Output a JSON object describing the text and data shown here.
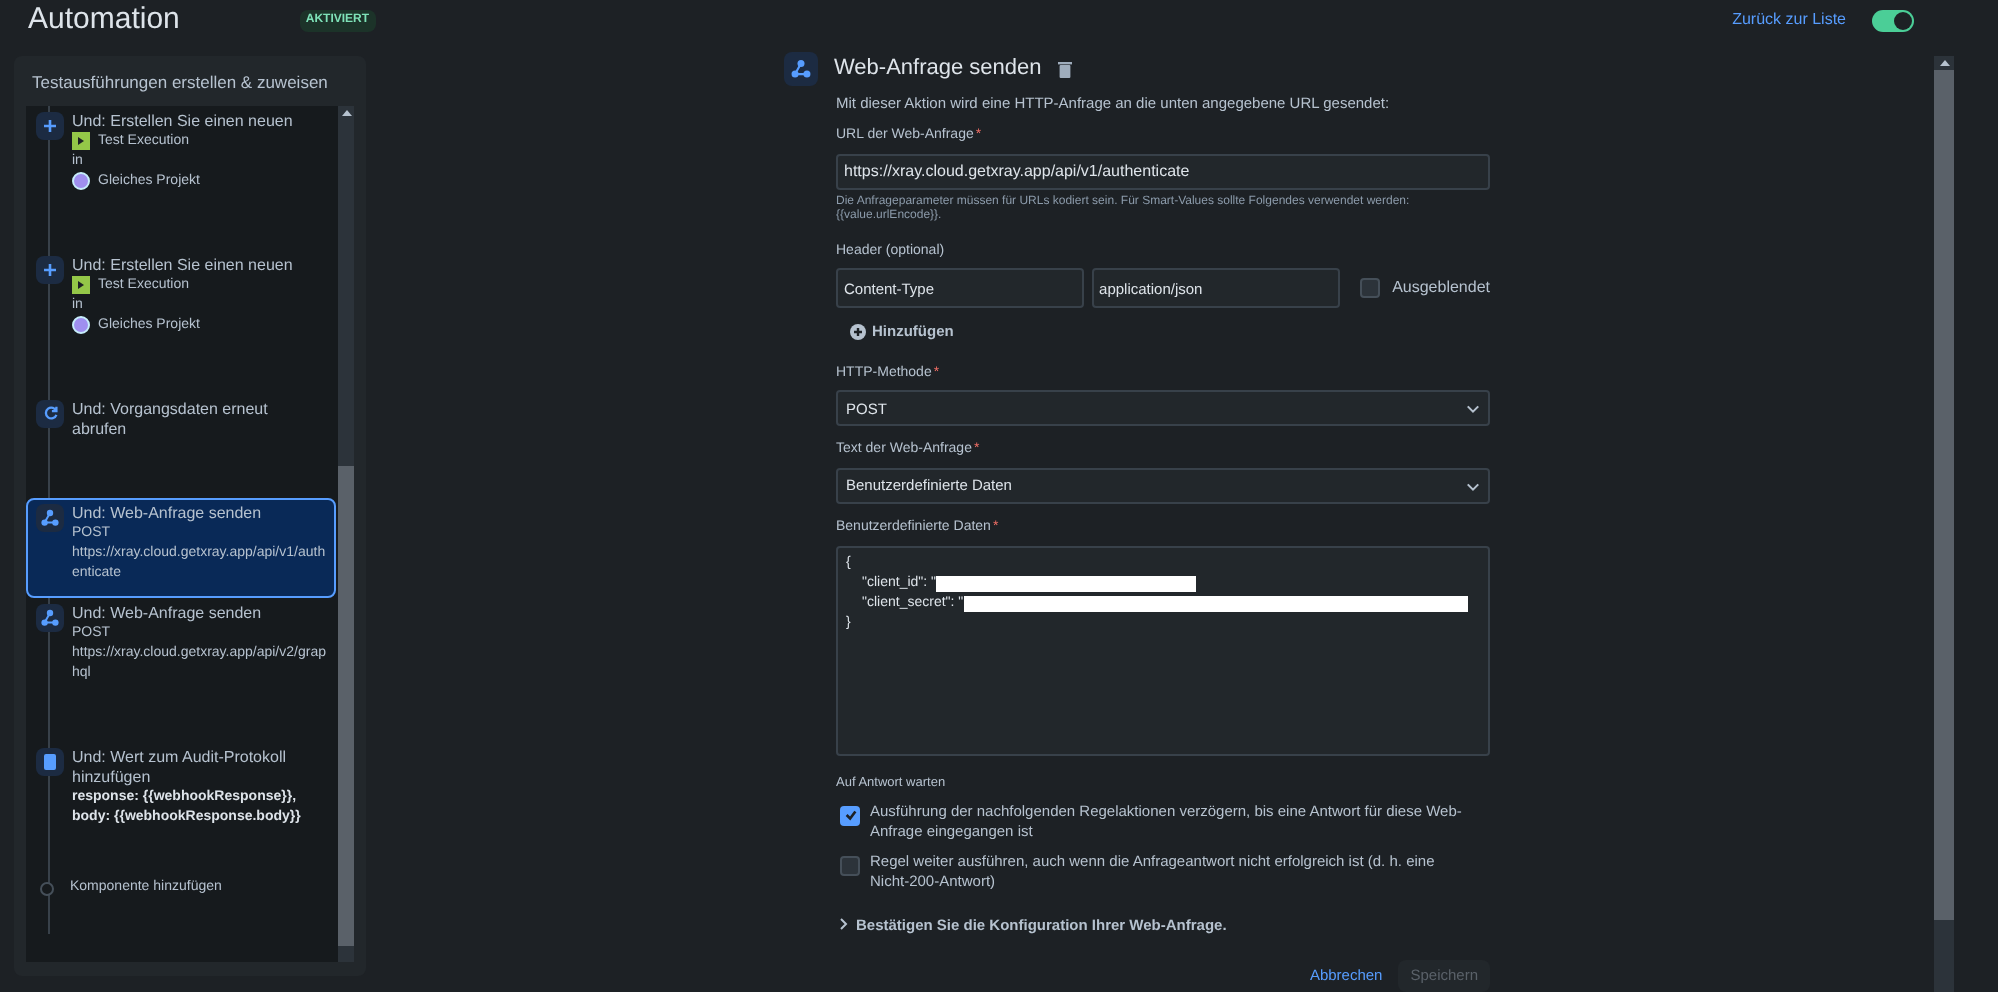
{
  "header": {
    "title": "Automation",
    "badge": "AKTIVIERT",
    "back_link": "Zurück zur Liste",
    "toggle_on": true
  },
  "sidebar": {
    "title": "Testausführungen erstellen & zuweisen",
    "items": [
      {
        "kind": "create",
        "selected": false,
        "title": "Und: Erstellen Sie einen neuen",
        "lines": [
          "Test Execution",
          "in",
          "Gleiches Projekt"
        ]
      },
      {
        "kind": "create",
        "selected": false,
        "title": "Und: Erstellen Sie einen neuen",
        "lines": [
          "Test Execution",
          "in",
          "Gleiches Projekt"
        ]
      },
      {
        "kind": "refresh",
        "selected": false,
        "title": "Und: Vorgangsdaten erneut abrufen"
      },
      {
        "kind": "webhook",
        "selected": true,
        "title": "Und: Web-Anfrage senden",
        "lines": [
          "POST",
          "https://xray.cloud.getxray.app/api/v1/authenticate"
        ]
      },
      {
        "kind": "webhook",
        "selected": false,
        "title": "Und: Web-Anfrage senden",
        "lines": [
          "POST",
          "https://xray.cloud.getxray.app/api/v2/graphql"
        ]
      },
      {
        "kind": "log",
        "selected": false,
        "title": "Und: Wert zum Audit-Protokoll hinzufügen",
        "lines": [
          "response: {{webhookResponse}},",
          "body: {{webhookResponse.body}}"
        ]
      }
    ],
    "add_component": "Komponente hinzufügen"
  },
  "form": {
    "required_mark": "*",
    "title": "Web-Anfrage senden",
    "description": "Mit dieser Aktion wird eine HTTP-Anfrage an die unten angegebene URL gesendet:",
    "url_label": "URL der Web-Anfrage",
    "url_value": "https://xray.cloud.getxray.app/api/v1/authenticate",
    "url_hint": "Die Anfrageparameter müssen für URLs kodiert sein. Für Smart-Values sollte Folgendes verwendet werden: {{value.urlEncode}}.",
    "headers_label": "Header (optional)",
    "header_name": "Content-Type",
    "header_value": "application/json",
    "hidden_label": "Ausgeblendet",
    "hidden_checked": false,
    "add_header": "Hinzufügen",
    "method_label": "HTTP-Methode",
    "method_value": "POST",
    "body_label": "Text der Web-Anfrage",
    "body_value": "Benutzerdefinierte Daten",
    "custom_label": "Benutzerdefinierte Daten",
    "custom_lines": [
      "{",
      "\"client_id\": \"",
      "\"client_secret\": \"",
      "}"
    ],
    "wait_label": "Auf Antwort warten",
    "options": [
      {
        "label": "Ausführung der nachfolgenden Regelaktionen verzögern, bis eine Antwort für diese Web-Anfrage eingegangen ist",
        "checked": true
      },
      {
        "label": "Regel weiter ausführen, auch wenn die Anfrageantwort nicht erfolgreich ist (d. h. eine Nicht-200-Antwort)",
        "checked": false
      }
    ],
    "validate": "Bestätigen Sie die Konfiguration Ihrer Web-Anfrage.",
    "cancel": "Abbrechen",
    "save": "Speichern"
  }
}
